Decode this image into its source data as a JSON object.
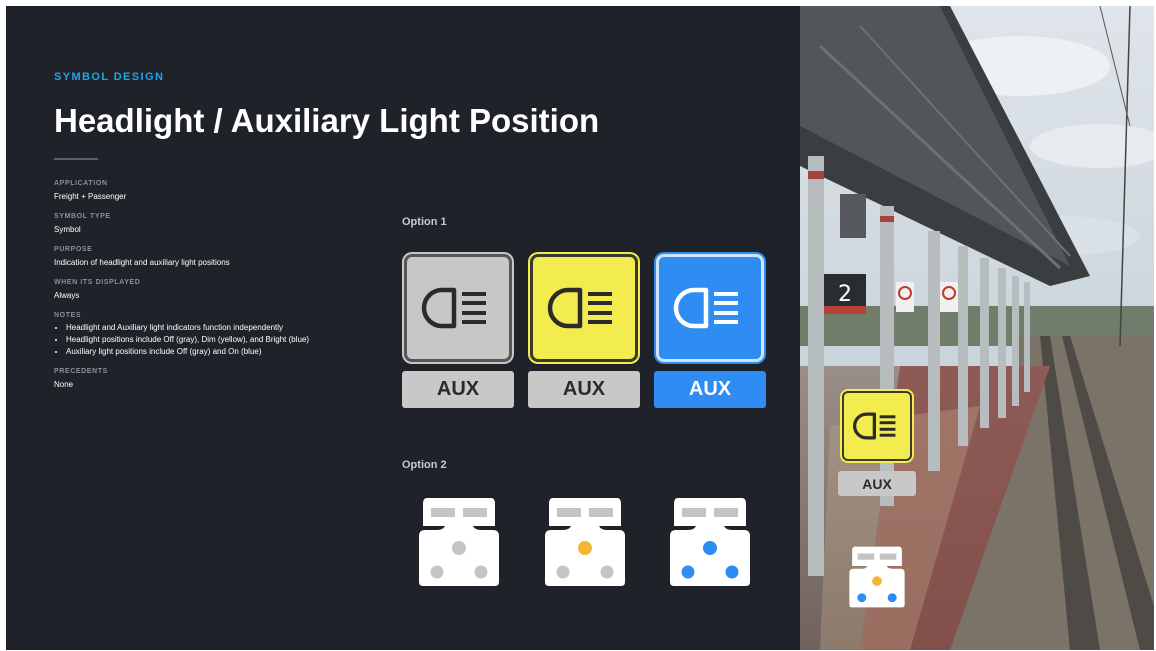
{
  "header": {
    "eyebrow": "SYMBOL DESIGN",
    "title": "Headlight / Auxiliary Light Position"
  },
  "meta": {
    "application": {
      "label": "APPLICATION",
      "value": "Freight + Passenger"
    },
    "symbol_type": {
      "label": "SYMBOL TYPE",
      "value": "Symbol"
    },
    "purpose": {
      "label": "PURPOSE",
      "value": "Indication of headlight and auxiliary light positions"
    },
    "when_displayed": {
      "label": "WHEN ITS DISPLAYED",
      "value": "Always"
    },
    "notes": {
      "label": "NOTES",
      "items": [
        "Headlight and Auxiliary light indicators function independently",
        "Headlight positions include Off (gray), Dim (yellow), and Bright (blue)",
        "Auxiliary light positions include Off (gray) and On (blue)"
      ]
    },
    "precedents": {
      "label": "PRECEDENTS",
      "value": "None"
    }
  },
  "option1": {
    "label": "Option 1",
    "items": [
      {
        "state": "off",
        "color": "#c7c7c7",
        "aux_label": "AUX",
        "aux_state": "off"
      },
      {
        "state": "dim",
        "color": "#f2ec4f",
        "aux_label": "AUX",
        "aux_state": "off"
      },
      {
        "state": "bright",
        "color": "#2f8cf2",
        "aux_label": "AUX",
        "aux_state": "on"
      }
    ]
  },
  "option2": {
    "label": "Option 2",
    "items": [
      {
        "state": "off",
        "light_color": "#c4c4c4",
        "aux_color": "#c4c4c4"
      },
      {
        "state": "dim",
        "light_color": "#f2b632",
        "aux_color": "#c4c4c4"
      },
      {
        "state": "bright",
        "light_color": "#2f8cf2",
        "aux_color": "#2f8cf2"
      }
    ]
  },
  "photo": {
    "track_number": "2",
    "overlay_aux": "AUX",
    "icons": [
      "headlight-icon",
      "locomotive-front-icon"
    ]
  },
  "colors": {
    "accent": "#1fa4e6",
    "off": "#c7c7c7",
    "dim": "#f2ec4f",
    "bright": "#2f8cf2",
    "background": "#1f2329"
  }
}
